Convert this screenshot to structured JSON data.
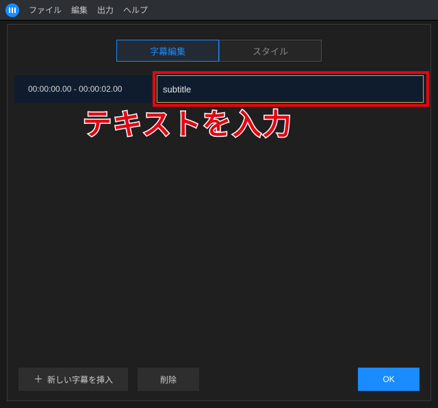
{
  "menubar": {
    "items": [
      "ファイル",
      "編集",
      "出力",
      "ヘルプ"
    ]
  },
  "tabs": {
    "edit": "字幕編集",
    "style": "スタイル"
  },
  "subtitle": {
    "time": "00:00:00.00 - 00:00:02.00",
    "text": "subtitle"
  },
  "callout": "テキストを入力",
  "buttons": {
    "insert": "新しい字幕を挿入",
    "delete": "削除",
    "ok": "OK"
  }
}
